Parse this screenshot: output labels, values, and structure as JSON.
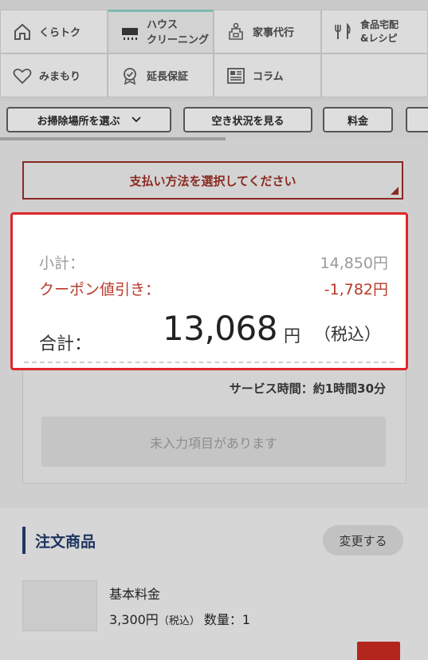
{
  "nav": {
    "items": [
      {
        "label": "くらトク",
        "icon": "home-icon"
      },
      {
        "label_line1": "ハウス",
        "label_line2": "クリーニング",
        "icon": "aircon-icon",
        "active": true
      },
      {
        "label": "家事代行",
        "icon": "apron-icon"
      },
      {
        "label_line1": "食品宅配",
        "label_line2": "&レシピ",
        "icon": "fork-knife-icon"
      },
      {
        "label": "みまもり",
        "icon": "heart-icon"
      },
      {
        "label": "延長保証",
        "icon": "badge-check-icon"
      },
      {
        "label": "コラム",
        "icon": "article-icon"
      }
    ]
  },
  "filters": {
    "select_area": "お掃除場所を選ぶ",
    "availability": "空き状況を見る",
    "price": "料金"
  },
  "payment": {
    "placeholder": "支払い方法を選択してください"
  },
  "summary": {
    "subtotal_label": "小計：",
    "subtotal_value": "14,850円",
    "coupon_label": "クーポン値引き：",
    "coupon_value": "-1,782円",
    "total_label": "合計：",
    "total_value": "13,068",
    "total_unit": "円",
    "total_tax": "（税込）"
  },
  "service_time": "サービス時間：約1時間30分",
  "submit_label": "未入力項目があります",
  "order": {
    "title": "注文商品",
    "change_label": "変更する",
    "item_name": "基本料金",
    "item_price": "3,300円",
    "item_tax": "（税込）",
    "item_qty": "数量：1"
  },
  "colors": {
    "accent_red": "#e0262b",
    "brand_navy": "#1f3561",
    "coupon_red": "#b83a2c"
  }
}
